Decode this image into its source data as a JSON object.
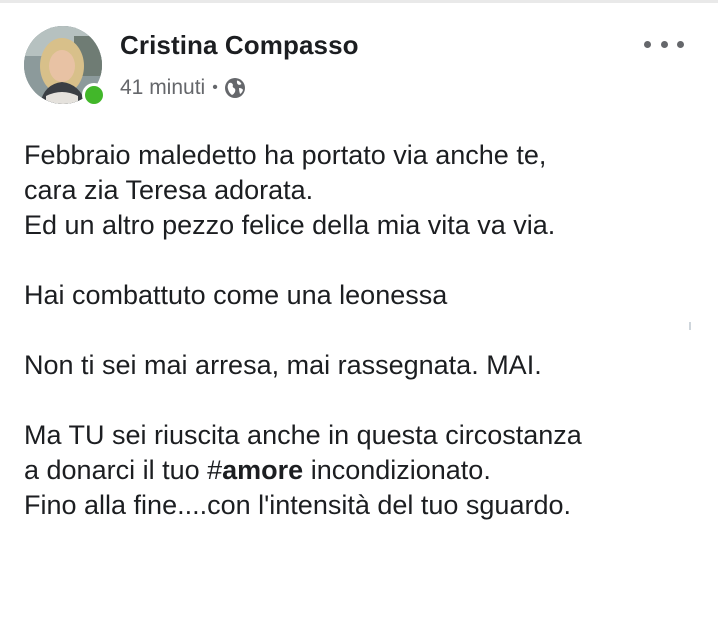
{
  "post": {
    "author": {
      "name": "Cristina Compasso",
      "avatar_icon": "profile-photo",
      "online": true,
      "online_color": "#42b72a"
    },
    "timestamp": "41 minuti",
    "separator": "•",
    "audience_icon": "globe-icon",
    "more_icon": "ellipsis-icon",
    "lines": [
      "Febbraio maledetto ha portato via anche te,",
      "cara zia Teresa adorata.",
      "Ed un altro pezzo felice della mia vita va via.",
      "",
      "Hai combattuto come una leonessa",
      "",
      "Non ti sei mai arresa, mai rassegnata. MAI.",
      "",
      "Ma TU sei riuscita anche in questa circostanza"
    ],
    "hashtag_line": {
      "before": "a donarci il tuo ",
      "hash": "#",
      "tag": "amore",
      "after": " incondizionato."
    },
    "last_line": "Fino alla fine....con l'intensità del tuo sguardo."
  },
  "colors": {
    "text": "#1c1e21",
    "secondary_text": "#65676b",
    "online_badge": "#42b72a"
  }
}
